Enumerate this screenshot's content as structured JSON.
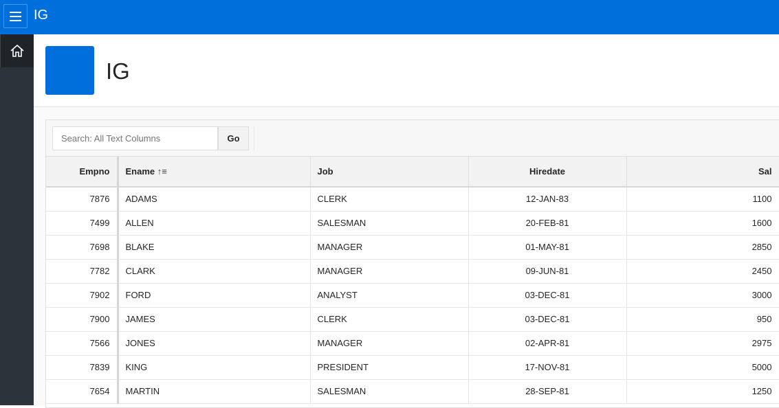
{
  "app": {
    "title": "IG"
  },
  "page": {
    "title": "IG"
  },
  "search": {
    "placeholder": "Search: All Text Columns",
    "go_label": "Go"
  },
  "columns": [
    "Empno",
    "Ename",
    "Job",
    "Hiredate",
    "Sal"
  ],
  "sort_indicator": "↑≡",
  "rows": [
    [
      "7876",
      "ADAMS",
      "CLERK",
      "12-JAN-83",
      "1100"
    ],
    [
      "7499",
      "ALLEN",
      "SALESMAN",
      "20-FEB-81",
      "1600"
    ],
    [
      "7698",
      "BLAKE",
      "MANAGER",
      "01-MAY-81",
      "2850"
    ],
    [
      "7782",
      "CLARK",
      "MANAGER",
      "09-JUN-81",
      "2450"
    ],
    [
      "7902",
      "FORD",
      "ANALYST",
      "03-DEC-81",
      "3000"
    ],
    [
      "7900",
      "JAMES",
      "CLERK",
      "03-DEC-81",
      "950"
    ],
    [
      "7566",
      "JONES",
      "MANAGER",
      "02-APR-81",
      "2975"
    ],
    [
      "7839",
      "KING",
      "PRESIDENT",
      "17-NOV-81",
      "5000"
    ],
    [
      "7654",
      "MARTIN",
      "SALESMAN",
      "28-SEP-81",
      "1250"
    ]
  ]
}
